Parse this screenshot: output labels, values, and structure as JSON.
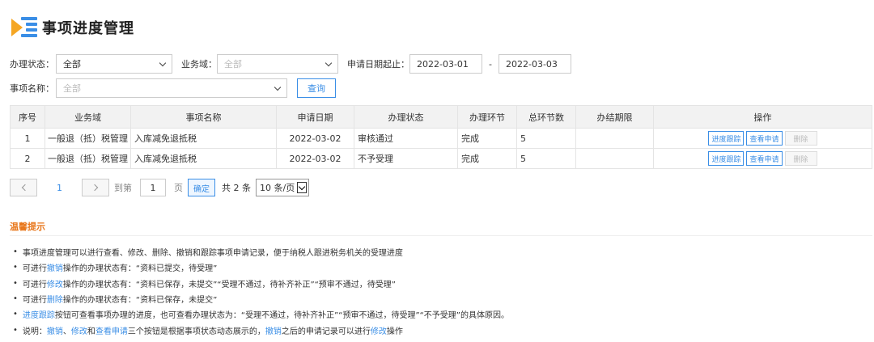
{
  "page": {
    "title": "事项进度管理"
  },
  "filters": {
    "status_label": "办理状态：",
    "status_value": "全部",
    "domain_label": "业务域：",
    "domain_placeholder": "全部",
    "date_label": "申请日期起止：",
    "date_from": "2022-03-01",
    "date_sep": "-",
    "date_to": "2022-03-03",
    "name_label": "事项名称：",
    "name_placeholder": "全部",
    "query_button": "查询"
  },
  "table": {
    "headers": [
      "序号",
      "业务域",
      "事项名称",
      "申请日期",
      "办理状态",
      "办理环节",
      "总环节数",
      "办结期限",
      "操作"
    ],
    "rows": [
      {
        "no": "1",
        "domain": "一般退（抵）税管理",
        "name": "入库减免退抵税",
        "date": "2022-03-02",
        "status": "审核通过",
        "stage": "完成",
        "total": "5",
        "deadline": ""
      },
      {
        "no": "2",
        "domain": "一般退（抵）税管理",
        "name": "入库减免退抵税",
        "date": "2022-03-02",
        "status": "不予受理",
        "stage": "完成",
        "total": "5",
        "deadline": ""
      }
    ],
    "ops": {
      "track": "进度跟踪",
      "view": "查看申请",
      "delete": "删除"
    }
  },
  "pager": {
    "current": "1",
    "goto_prefix": "到第",
    "goto_value": "1",
    "goto_suffix": "页",
    "confirm": "确定",
    "total": "共 2 条",
    "page_size": "10 条/页"
  },
  "tips": {
    "title": "温馨提示",
    "l1": "事项进度管理可以进行查看、修改、删除、撤销和跟踪事项申请记录，便于纳税人跟进税务机关的受理进度",
    "l2a": "可进行",
    "l2b": "撤销",
    "l2c": "操作的办理状态有：“资料已提交，待受理”",
    "l3a": "可进行",
    "l3b": "修改",
    "l3c": "操作的办理状态有：“资料已保存，未提交”“受理不通过，待补齐补正”“预审不通过，待受理”",
    "l4a": "可进行",
    "l4b": "删除",
    "l4c": "操作的办理状态有：“资料已保存，未提交”",
    "l5a": "进度跟踪",
    "l5b": "按钮可查看事项办理的进度，也可查看办理状态为：“受理不通过，待补齐补正”“预审不通过，待受理”“不予受理”的具体原因。",
    "l6a": "说明：",
    "l6b": "撤销",
    "l6c": "、",
    "l6d": "修改",
    "l6e": "和",
    "l6f": "查看申请",
    "l6g": "三个按钮是根据事项状态动态展示的，",
    "l6h": "撤销",
    "l6i": "之后的申请记录可以进行",
    "l6j": "修改",
    "l6k": "操作"
  },
  "colors": {
    "accent": "#3a8ee6",
    "tip_title": "#e8761a",
    "logo_triangle": "#f5a623"
  }
}
